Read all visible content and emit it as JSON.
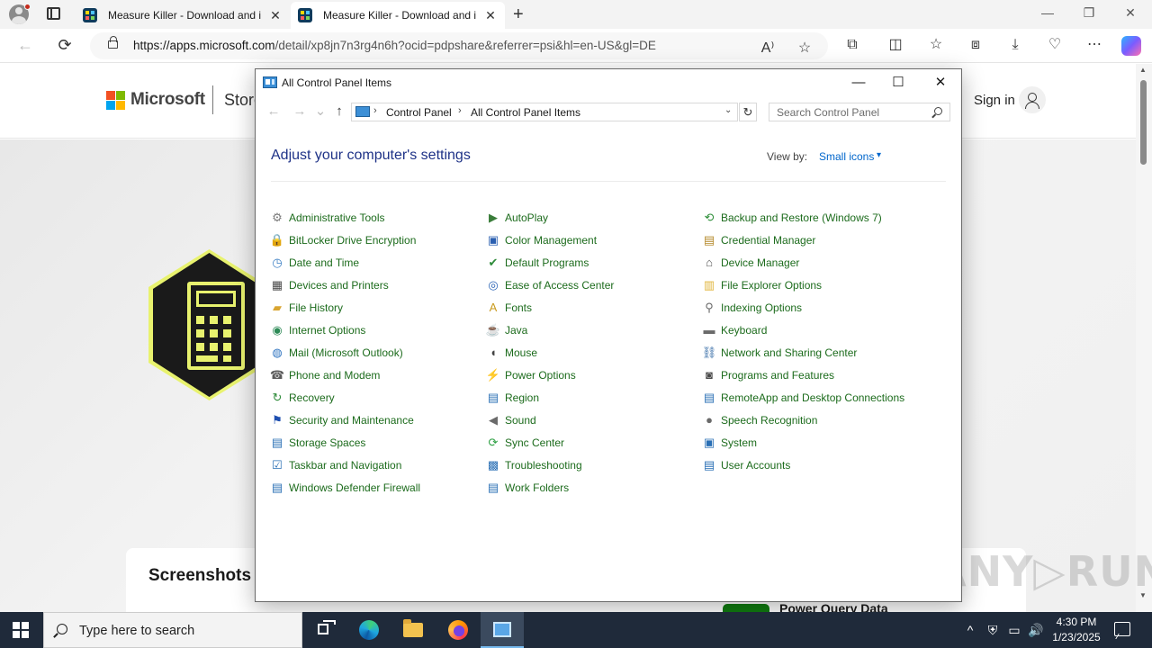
{
  "browser": {
    "tabs": [
      {
        "title": "Measure Killer - Download and install on Windows | Microsoft Store",
        "active": false
      },
      {
        "title": "Measure Killer - Download and install on Windows | Microsoft Store",
        "active": true
      }
    ],
    "tab_close": "✕",
    "new_tab": "+",
    "window_controls": {
      "minimize": "—",
      "restore": "❐",
      "close": "✕"
    },
    "url_host": "https://apps.microsoft.com",
    "url_path": "/detail/xp8jn7n3rg4n6h?ocid=pdpshare&referrer=psi&hl=en-US&gl=DE",
    "nav": {
      "back": "←",
      "refresh": "⟳"
    },
    "toolbar_icons": [
      "read-aloud-icon",
      "favorite-star-icon",
      "extensions-icon",
      "split-screen-icon",
      "favorites-icon",
      "collections-icon",
      "downloads-icon",
      "browser-essentials-icon",
      "more-menu-icon",
      "copilot-icon"
    ]
  },
  "store": {
    "brand": "Microsoft",
    "store_label": "Store",
    "sign_in": "Sign in",
    "screenshots_heading": "Screenshots",
    "partial_text": "Power Query Data"
  },
  "control_panel": {
    "window_title": "All Control Panel Items",
    "window_controls": {
      "minimize": "—",
      "maximize": "☐",
      "close": "✕"
    },
    "nav": {
      "back": "←",
      "forward": "→",
      "recent": "⌄",
      "up": "↑"
    },
    "breadcrumbs": [
      "Control Panel",
      "All Control Panel Items"
    ],
    "crumb_separator": "›",
    "dropdown": "⌄",
    "refresh": "↻",
    "search_placeholder": "Search Control Panel",
    "heading": "Adjust your computer's settings",
    "view_by_label": "View by:",
    "view_by_value": "Small icons",
    "view_by_arrow": "▾",
    "items": [
      {
        "label": "Administrative Tools",
        "icon": "administrative-tools-icon",
        "glyph": "⚙",
        "color": "#7a7a7a"
      },
      {
        "label": "AutoPlay",
        "icon": "autoplay-icon",
        "glyph": "▶",
        "color": "#3a7d3a"
      },
      {
        "label": "Backup and Restore (Windows 7)",
        "icon": "backup-restore-icon",
        "glyph": "⟲",
        "color": "#2f8f3a"
      },
      {
        "label": "BitLocker Drive Encryption",
        "icon": "bitlocker-icon",
        "glyph": "🔒",
        "color": "#c89a2a"
      },
      {
        "label": "Color Management",
        "icon": "color-management-icon",
        "glyph": "▣",
        "color": "#2a5fb0"
      },
      {
        "label": "Credential Manager",
        "icon": "credential-manager-icon",
        "glyph": "▤",
        "color": "#b58a2b"
      },
      {
        "label": "Date and Time",
        "icon": "date-time-icon",
        "glyph": "◷",
        "color": "#3c7fc4"
      },
      {
        "label": "Default Programs",
        "icon": "default-programs-icon",
        "glyph": "✔",
        "color": "#2e8b3a"
      },
      {
        "label": "Device Manager",
        "icon": "device-manager-icon",
        "glyph": "⌂",
        "color": "#555555"
      },
      {
        "label": "Devices and Printers",
        "icon": "devices-printers-icon",
        "glyph": "▦",
        "color": "#4a4a4a"
      },
      {
        "label": "Ease of Access Center",
        "icon": "ease-of-access-icon",
        "glyph": "◎",
        "color": "#2a63b5"
      },
      {
        "label": "File Explorer Options",
        "icon": "file-explorer-options-icon",
        "glyph": "▥",
        "color": "#e0b43a"
      },
      {
        "label": "File History",
        "icon": "file-history-icon",
        "glyph": "▰",
        "color": "#d9a531"
      },
      {
        "label": "Fonts",
        "icon": "fonts-icon",
        "glyph": "A",
        "color": "#c99a1e"
      },
      {
        "label": "Indexing Options",
        "icon": "indexing-options-icon",
        "glyph": "⚲",
        "color": "#6a6a6a"
      },
      {
        "label": "Internet Options",
        "icon": "internet-options-icon",
        "glyph": "◉",
        "color": "#2e8b57"
      },
      {
        "label": "Java",
        "icon": "java-icon",
        "glyph": "☕",
        "color": "#d25b1e"
      },
      {
        "label": "Keyboard",
        "icon": "keyboard-icon",
        "glyph": "▬",
        "color": "#6a6a6a"
      },
      {
        "label": "Mail (Microsoft Outlook)",
        "icon": "mail-icon",
        "glyph": "◍",
        "color": "#2f74c0"
      },
      {
        "label": "Mouse",
        "icon": "mouse-icon",
        "glyph": "◖",
        "color": "#444444"
      },
      {
        "label": "Network and Sharing Center",
        "icon": "network-sharing-icon",
        "glyph": "⛓",
        "color": "#3a6fa8"
      },
      {
        "label": "Phone and Modem",
        "icon": "phone-modem-icon",
        "glyph": "☎",
        "color": "#5a5a5a"
      },
      {
        "label": "Power Options",
        "icon": "power-options-icon",
        "glyph": "⚡",
        "color": "#3a8a3a"
      },
      {
        "label": "Programs and Features",
        "icon": "programs-features-icon",
        "glyph": "◙",
        "color": "#4a4a4a"
      },
      {
        "label": "Recovery",
        "icon": "recovery-icon",
        "glyph": "↻",
        "color": "#2e8b3a"
      },
      {
        "label": "Region",
        "icon": "region-icon",
        "glyph": "▤",
        "color": "#2a6fb5"
      },
      {
        "label": "RemoteApp and Desktop Connections",
        "icon": "remoteapp-icon",
        "glyph": "▤",
        "color": "#2a6fb5"
      },
      {
        "label": "Security and Maintenance",
        "icon": "security-maintenance-icon",
        "glyph": "⚑",
        "color": "#1e4fb0"
      },
      {
        "label": "Sound",
        "icon": "sound-icon",
        "glyph": "◀",
        "color": "#6a6a6a"
      },
      {
        "label": "Speech Recognition",
        "icon": "speech-recognition-icon",
        "glyph": "●",
        "color": "#6a6a6a"
      },
      {
        "label": "Storage Spaces",
        "icon": "storage-spaces-icon",
        "glyph": "▤",
        "color": "#2a6fb5"
      },
      {
        "label": "Sync Center",
        "icon": "sync-center-icon",
        "glyph": "⟳",
        "color": "#2ea043"
      },
      {
        "label": "System",
        "icon": "system-icon",
        "glyph": "▣",
        "color": "#2a6fb5"
      },
      {
        "label": "Taskbar and Navigation",
        "icon": "taskbar-navigation-icon",
        "glyph": "☑",
        "color": "#2a6fb5"
      },
      {
        "label": "Troubleshooting",
        "icon": "troubleshooting-icon",
        "glyph": "▩",
        "color": "#2a6fb5"
      },
      {
        "label": "User Accounts",
        "icon": "user-accounts-icon",
        "glyph": "▤",
        "color": "#2a6fb5"
      },
      {
        "label": "Windows Defender Firewall",
        "icon": "windows-defender-firewall-icon",
        "glyph": "▤",
        "color": "#2a6fb5"
      },
      {
        "label": "Work Folders",
        "icon": "work-folders-icon",
        "glyph": "▤",
        "color": "#2a6fb5"
      }
    ]
  },
  "taskbar": {
    "search_placeholder": "Type here to search",
    "time": "4:30 PM",
    "date": "1/23/2025",
    "tray": {
      "chevron": "^",
      "volume": "🔊"
    }
  },
  "colors": {
    "accent_link": "#0066cc",
    "heading_blue": "#1e3287",
    "item_green": "#1c6b1c",
    "taskbar_bg": "#1f2a3a"
  }
}
